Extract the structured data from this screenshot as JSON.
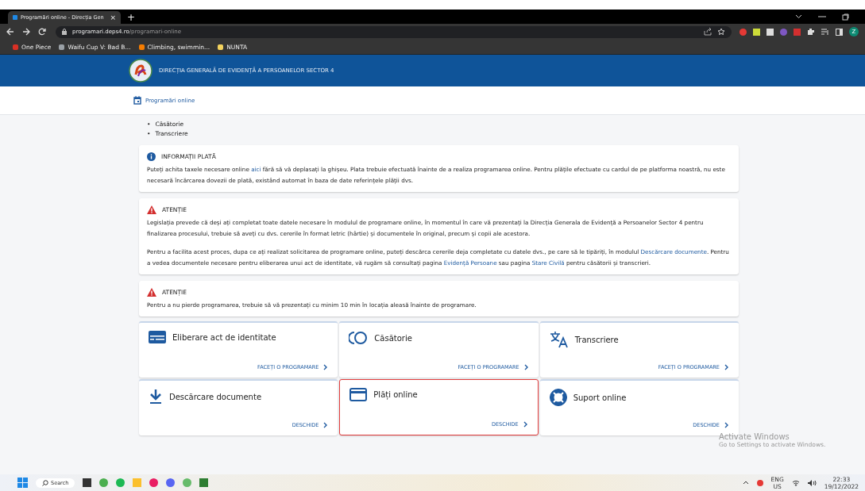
{
  "browser": {
    "tab": {
      "title": "Programări online - Direcția Gen",
      "close": "×"
    },
    "new_tab": "+",
    "address": {
      "domain": "programari.deps4.ro",
      "path": "/programari-online"
    },
    "bookmarks": [
      {
        "label": "One Piece",
        "color": "#d93025"
      },
      {
        "label": "Waifu Cup V: Bad B...",
        "color": "#9aa0a6"
      },
      {
        "label": "Climbing, swimmin...",
        "color": "#f57c00"
      },
      {
        "label": "NUNTA",
        "color": "#f4d35e"
      }
    ],
    "profile": "Z"
  },
  "header": {
    "title": "DIRECȚIA GENERALĂ DE EVIDENȚĂ A PERSOANELOR SECTOR 4"
  },
  "nav": {
    "label": "Programări online"
  },
  "list": [
    {
      "bullet": "•",
      "text": "Căsătorie"
    },
    {
      "bullet": "•",
      "text": "Transcriere"
    }
  ],
  "notices": [
    {
      "kind": "info",
      "title": "INFORMAȚII PLATĂ",
      "paragraphs": [
        [
          {
            "text": "Puteți achita taxele necesare online "
          },
          {
            "text": "aici",
            "link": true
          },
          {
            "text": " fără să vă deplasați la ghișeu. Plata trebuie efectuată înainte de a realiza programarea online. Pentru plățile efectuate cu cardul de pe platforma noastră, nu este necesară încărcarea dovezii de plată, existând automat în baza de date referințele plății dvs."
          }
        ]
      ]
    },
    {
      "kind": "warning",
      "title": "ATENȚIE",
      "paragraphs": [
        [
          {
            "text": "Legislația prevede că deși ați completat toate datele necesare în modulul de programare online, în momentul în care vă prezentați la Direcția Generala de Evidență a Persoanelor Sector 4 pentru finalizarea procesului, trebuie să aveți cu dvs. cererile în format letric (hârtie) și documentele în original, precum și copii ale acestora."
          }
        ],
        [
          {
            "text": "Pentru a facilita acest proces, dupa ce ați realizat solicitarea de programare online, puteți descărca cererile deja completate cu datele dvs., pe care să le tipăriți, în modulul "
          },
          {
            "text": "Descărcare documente",
            "link": true
          },
          {
            "text": ". Pentru a vedea documentele necesare pentru eliberarea unui act de identitate, vă rugăm să consultați pagina "
          },
          {
            "text": "Evidență Persoane",
            "link": true
          },
          {
            "text": " sau pagina "
          },
          {
            "text": "Stare Civilă",
            "link": true
          },
          {
            "text": " pentru căsătorii și transcrieri."
          }
        ]
      ]
    },
    {
      "kind": "warning",
      "title": "ATENȚIE",
      "paragraphs": [
        [
          {
            "text": "Pentru a nu pierde programarea, trebuie să vă prezentați cu minim 10 min în locația aleasă înainte de programare."
          }
        ]
      ]
    }
  ],
  "cards": [
    {
      "kind": "id-card",
      "title": "Eliberare act de identitate",
      "action": "FACEȚI O PROGRAMARE",
      "highlighted": false
    },
    {
      "kind": "rings",
      "title": "Căsătorie",
      "action": "FACEȚI O PROGRAMARE",
      "highlighted": false
    },
    {
      "kind": "translate",
      "title": "Transcriere",
      "action": "FACEȚI O PROGRAMARE",
      "highlighted": false
    },
    {
      "kind": "download",
      "title": "Descărcare documente",
      "action": "DESCHIDE",
      "highlighted": false
    },
    {
      "kind": "card",
      "title": "Plăți online",
      "action": "DESCHIDE",
      "highlighted": true
    },
    {
      "kind": "support",
      "title": "Suport online",
      "action": "DESCHIDE",
      "highlighted": false
    }
  ],
  "os_notice": {
    "title": "Activate Windows",
    "subtitle": "Go to Settings to activate Windows."
  },
  "taskbar": {
    "search": "Search",
    "language": "ENG",
    "region": "US",
    "time": "22:33",
    "date": "19/12/2022"
  }
}
